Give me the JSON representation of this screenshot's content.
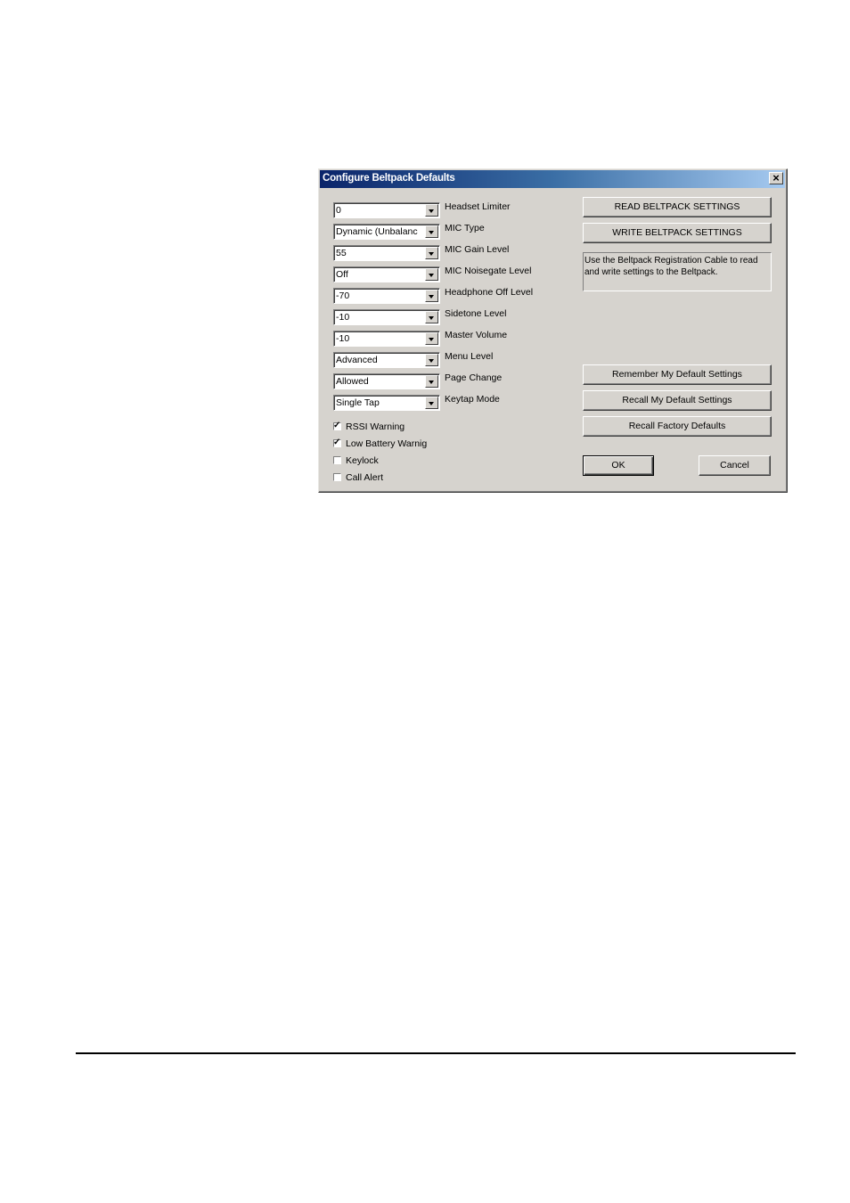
{
  "dialog": {
    "title": "Configure Beltpack Defaults",
    "close_icon": "close-icon",
    "settings": [
      {
        "label": "Headset Limiter",
        "value": "0"
      },
      {
        "label": "MIC Type",
        "value": "Dynamic (Unbalanc"
      },
      {
        "label": "MIC Gain Level",
        "value": "55"
      },
      {
        "label": "MIC Noisegate Level",
        "value": "Off"
      },
      {
        "label": "Headphone Off Level",
        "value": "-70"
      },
      {
        "label": "Sidetone Level",
        "value": "-10"
      },
      {
        "label": "Master Volume",
        "value": "-10"
      },
      {
        "label": "Menu Level",
        "value": "Advanced"
      },
      {
        "label": "Page Change",
        "value": "Allowed"
      },
      {
        "label": "Keytap Mode",
        "value": "Single Tap"
      }
    ],
    "checkboxes": [
      {
        "label": "RSSI Warning",
        "checked": true,
        "mark": "✓"
      },
      {
        "label": "Low Battery Warnig",
        "checked": true,
        "mark": "✓"
      },
      {
        "label": "Keylock",
        "checked": false,
        "mark": ""
      },
      {
        "label": "Call Alert",
        "checked": false,
        "mark": ""
      }
    ],
    "buttons": {
      "read": "READ BELTPACK SETTINGS",
      "write": "WRITE BELTPACK SETTINGS",
      "remember": "Remember My Default Settings",
      "recall_my": "Recall My Default Settings",
      "recall_factory": "Recall Factory Defaults",
      "ok": "OK",
      "cancel": "Cancel"
    },
    "info_text": "Use the Beltpack Registration Cable to read and write settings to the Beltpack."
  }
}
